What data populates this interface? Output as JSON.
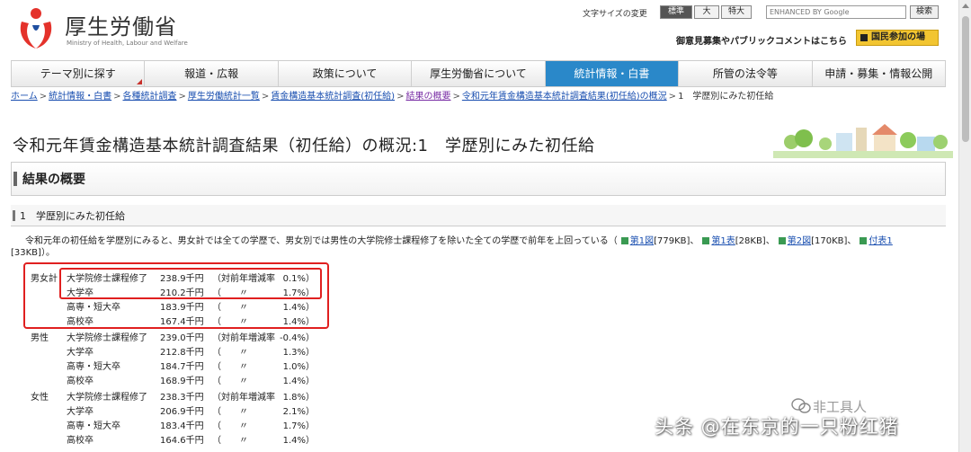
{
  "header": {
    "logo_title": "厚生労働省",
    "logo_sub": "Ministry of Health, Labour and Welfare",
    "font_size_label": "文字サイズの変更",
    "font_sizes": [
      "標準",
      "大",
      "特大"
    ],
    "search_placeholder": "ENHANCED BY Google",
    "search_button": "検索",
    "opinion_link": "御意見募集やパブリックコメントはこちら",
    "participate_button": "国民参加の場"
  },
  "nav": {
    "items": [
      {
        "label": "テーマ別に探す"
      },
      {
        "label": "報道・広報"
      },
      {
        "label": "政策について"
      },
      {
        "label": "厚生労働省について"
      },
      {
        "label": "統計情報・白書"
      },
      {
        "label": "所管の法令等"
      },
      {
        "label": "申請・募集・情報公開"
      }
    ],
    "active_index": 4
  },
  "breadcrumb": {
    "links": [
      "ホーム",
      "統計情報・白書",
      "各種統計調査",
      "厚生労働統計一覧",
      "賃金構造基本統計調査(初任給)",
      "結果の概要",
      "令和元年賃金構造基本統計調査結果(初任給)の概況"
    ],
    "sep": ">",
    "current": "1　学歴別にみた初任給"
  },
  "page_title": "令和元年賃金構造基本統計調査結果（初任給）の概況:1　学歴別にみた初任給",
  "section_title": "結果の概要",
  "subsection_title": "1　学歴別にみた初任給",
  "summary": {
    "text": "令和元年の初任給を学歴別にみると、男女計では全ての学歴で、男女別では男性の大学院修士課程修了を除いた全ての学歴で前年を上回っている（",
    "files": [
      {
        "label": "第1図",
        "size": "[779KB]"
      },
      {
        "label": "第1表",
        "size": "[28KB]"
      },
      {
        "label": "第2図",
        "size": "[170KB]"
      },
      {
        "label": "付表1",
        "size": "[33KB]"
      }
    ],
    "tail": "）。"
  },
  "table": {
    "groups": [
      {
        "label": "男女計",
        "rows": [
          {
            "edu": "大学院修士課程修了",
            "val": "238.9千円",
            "open": "（対前年増減率",
            "mid": "",
            "rate": "0.1%）"
          },
          {
            "edu": "大学卒",
            "val": "210.2千円",
            "open": "（",
            "mid": "〃",
            "rate": "1.7%）"
          },
          {
            "edu": "高専・短大卒",
            "val": "183.9千円",
            "open": "（",
            "mid": "〃",
            "rate": "1.4%）"
          },
          {
            "edu": "高校卒",
            "val": "167.4千円",
            "open": "（",
            "mid": "〃",
            "rate": "1.4%）"
          }
        ]
      },
      {
        "label": "男性",
        "rows": [
          {
            "edu": "大学院修士課程修了",
            "val": "239.0千円",
            "open": "（対前年増減率",
            "mid": "",
            "rate": "-0.4%）"
          },
          {
            "edu": "大学卒",
            "val": "212.8千円",
            "open": "（",
            "mid": "〃",
            "rate": "1.3%）"
          },
          {
            "edu": "高専・短大卒",
            "val": "184.7千円",
            "open": "（",
            "mid": "〃",
            "rate": "1.0%）"
          },
          {
            "edu": "高校卒",
            "val": "168.9千円",
            "open": "（",
            "mid": "〃",
            "rate": "1.4%）"
          }
        ]
      },
      {
        "label": "女性",
        "rows": [
          {
            "edu": "大学院修士課程修了",
            "val": "238.3千円",
            "open": "（対前年増減率",
            "mid": "",
            "rate": "1.8%）"
          },
          {
            "edu": "大学卒",
            "val": "206.9千円",
            "open": "（",
            "mid": "〃",
            "rate": "2.1%）"
          },
          {
            "edu": "高専・短大卒",
            "val": "183.4千円",
            "open": "（",
            "mid": "〃",
            "rate": "1.7%）"
          },
          {
            "edu": "高校卒",
            "val": "164.6千円",
            "open": "（",
            "mid": "〃",
            "rate": "1.4%）"
          }
        ]
      }
    ]
  },
  "watermark": {
    "top": "非工具人",
    "main": "头条 @在东京的一只粉红猪"
  },
  "colors": {
    "active_nav": "#2a88c9",
    "highlight": "#e02020",
    "link": "#1a4fb0",
    "visited_link": "#7a2fa6",
    "participate": "#f2c531"
  }
}
